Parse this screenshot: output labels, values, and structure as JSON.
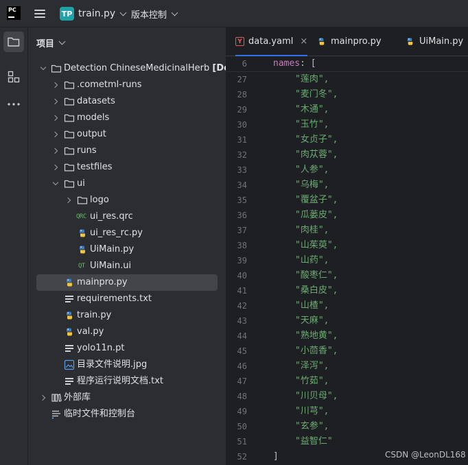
{
  "topbar": {
    "logo_text": "PC",
    "project_badge": "TP",
    "project_name": "train.py",
    "vcs_label": "版本控制"
  },
  "panel": {
    "title": "项目"
  },
  "tree": {
    "root": {
      "name": "Detection ChineseMedicinalHerb",
      "suffix": "[Detect"
    },
    "cometml_runs": ".cometml-runs",
    "datasets": "datasets",
    "models": "models",
    "output": "output",
    "runs": "runs",
    "testfiles": "testfiles",
    "ui": "ui",
    "logo": "logo",
    "ui_res_qrc": "ui_res.qrc",
    "ui_res_rc_py": "ui_res_rc.py",
    "uimain_py": "UiMain.py",
    "uimain_ui": "UiMain.ui",
    "mainpro_py": "mainpro.py",
    "requirements": "requirements.txt",
    "train_py": "train.py",
    "val_py": "val.py",
    "yolo_pt": "yolo11n.pt",
    "dir_jpg": "目录文件说明.jpg",
    "run_txt": "程序运行说明文档.txt",
    "external_libs": "外部库",
    "scratches": "临时文件和控制台"
  },
  "tabs": [
    {
      "label": "data.yaml",
      "close": "×"
    },
    {
      "label": "mainpro.py"
    },
    {
      "label": "UiMain.py"
    }
  ],
  "editor": {
    "sticky": {
      "ln": "6",
      "key": "names",
      "colon": ": ",
      "bracket": "["
    },
    "lines": [
      {
        "ln": "27",
        "text": "\"莲肉\","
      },
      {
        "ln": "28",
        "text": "\"麦门冬\","
      },
      {
        "ln": "29",
        "text": "\"木通\","
      },
      {
        "ln": "30",
        "text": "\"玉竹\","
      },
      {
        "ln": "31",
        "text": "\"女贞子\","
      },
      {
        "ln": "32",
        "text": "\"肉苁蓉\","
      },
      {
        "ln": "33",
        "text": "\"人参\","
      },
      {
        "ln": "34",
        "text": "\"乌梅\","
      },
      {
        "ln": "35",
        "text": "\"覆盆子\","
      },
      {
        "ln": "36",
        "text": "\"瓜蒌皮\","
      },
      {
        "ln": "37",
        "text": "\"肉桂\","
      },
      {
        "ln": "38",
        "text": "\"山茱萸\","
      },
      {
        "ln": "39",
        "text": "\"山药\","
      },
      {
        "ln": "40",
        "text": "\"酸枣仁\","
      },
      {
        "ln": "41",
        "text": "\"桑白皮\","
      },
      {
        "ln": "42",
        "text": "\"山楂\","
      },
      {
        "ln": "43",
        "text": "\"天麻\","
      },
      {
        "ln": "44",
        "text": "\"熟地黄\","
      },
      {
        "ln": "45",
        "text": "\"小茴香\","
      },
      {
        "ln": "46",
        "text": "\"泽泻\","
      },
      {
        "ln": "47",
        "text": "\"竹茹\","
      },
      {
        "ln": "48",
        "text": "\"川贝母\","
      },
      {
        "ln": "49",
        "text": "\"川芎\","
      },
      {
        "ln": "50",
        "text": "\"玄参\","
      },
      {
        "ln": "51",
        "text": "\"益智仁\""
      },
      {
        "ln": "52",
        "text": "]"
      }
    ]
  },
  "watermark": "CSDN @LeonDL168",
  "colors": {
    "background": "#1e1f22",
    "panel": "#2b2d30",
    "selection": "#43454a",
    "accent_tab": "#3574f0",
    "yaml_key": "#c77dbb",
    "yaml_string": "#6aab73",
    "project_badge": "#1fa3a8"
  }
}
